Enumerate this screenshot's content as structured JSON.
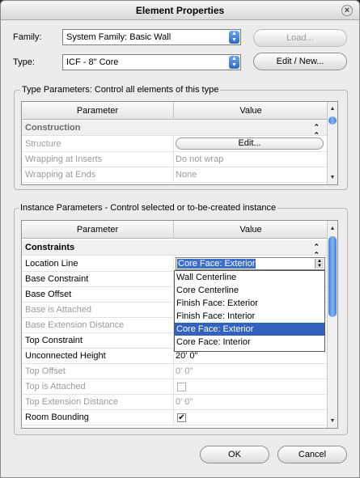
{
  "window": {
    "title": "Element Properties"
  },
  "family": {
    "label": "Family:",
    "value": "System Family: Basic Wall"
  },
  "type": {
    "label": "Type:",
    "value": "ICF - 8\" Core"
  },
  "buttons": {
    "load": "Load...",
    "edit_new": "Edit / New...",
    "ok": "OK",
    "cancel": "Cancel"
  },
  "type_params": {
    "title": "Type Parameters: Control all elements of this type",
    "header_param": "Parameter",
    "header_value": "Value",
    "section": "Construction",
    "rows": [
      {
        "name": "Structure",
        "value": "Edit..."
      },
      {
        "name": "Wrapping at Inserts",
        "value": "Do not wrap"
      },
      {
        "name": "Wrapping at Ends",
        "value": "None"
      }
    ]
  },
  "instance_params": {
    "title": "Instance Parameters - Control selected or to-be-created instance",
    "header_param": "Parameter",
    "header_value": "Value",
    "section": "Constraints",
    "rows": [
      {
        "name": "Location Line",
        "value": "Core Face: Exterior"
      },
      {
        "name": "Base Constraint",
        "value": ""
      },
      {
        "name": "Base Offset",
        "value": ""
      },
      {
        "name": "Base is Attached",
        "value": ""
      },
      {
        "name": "Base Extension Distance",
        "value": ""
      },
      {
        "name": "Top Constraint",
        "value": ""
      },
      {
        "name": "Unconnected Height",
        "value": "20'  0\""
      },
      {
        "name": "Top Offset",
        "value": "0'  0\""
      },
      {
        "name": "Top is Attached",
        "value": ""
      },
      {
        "name": "Top Extension Distance",
        "value": "0'  0\""
      },
      {
        "name": "Room Bounding",
        "value": ""
      }
    ],
    "dropdown_options": [
      "Wall Centerline",
      "Core Centerline",
      "Finish Face: Exterior",
      "Finish Face: Interior",
      "Core Face: Exterior",
      "Core Face: Interior"
    ],
    "selected_option": "Core Face: Exterior",
    "checks": {
      "top_is_attached": false,
      "room_bounding": true
    }
  }
}
